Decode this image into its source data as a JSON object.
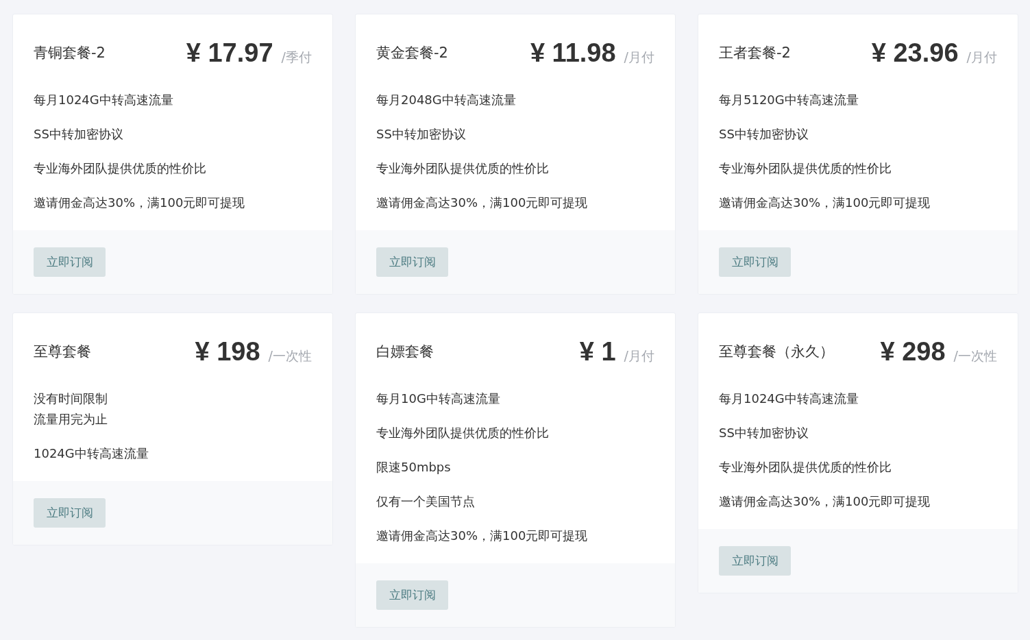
{
  "plans": [
    {
      "name": "青铜套餐-2",
      "price": "¥ 17.97",
      "period": "/季付",
      "features": [
        "每月1024G中转高速流量",
        "SS中转加密协议",
        "专业海外团队提供优质的性价比",
        "邀请佣金高达30%，满100元即可提现"
      ],
      "button": "立即订阅"
    },
    {
      "name": "黄金套餐-2",
      "price": "¥ 11.98",
      "period": "/月付",
      "features": [
        "每月2048G中转高速流量",
        "SS中转加密协议",
        "专业海外团队提供优质的性价比",
        "邀请佣金高达30%，满100元即可提现"
      ],
      "button": "立即订阅"
    },
    {
      "name": "王者套餐-2",
      "price": "¥ 23.96",
      "period": "/月付",
      "features": [
        "每月5120G中转高速流量",
        "SS中转加密协议",
        "专业海外团队提供优质的性价比",
        "邀请佣金高达30%，满100元即可提现"
      ],
      "button": "立即订阅"
    },
    {
      "name": "至尊套餐",
      "price": "¥ 198",
      "period": "/一次性",
      "features": [
        [
          "没有时间限制",
          "流量用完为止"
        ],
        "1024G中转高速流量"
      ],
      "button": "立即订阅"
    },
    {
      "name": "白嫖套餐",
      "price": "¥ 1",
      "period": "/月付",
      "features": [
        "每月10G中转高速流量",
        "专业海外团队提供优质的性价比",
        "限速50mbps",
        "仅有一个美国节点",
        "邀请佣金高达30%，满100元即可提现"
      ],
      "button": "立即订阅"
    },
    {
      "name": "至尊套餐（永久）",
      "price": "¥ 298",
      "period": "/一次性",
      "features": [
        "每月1024G中转高速流量",
        "SS中转加密协议",
        "专业海外团队提供优质的性价比",
        "邀请佣金高达30%，满100元即可提现"
      ],
      "button": "立即订阅"
    }
  ]
}
